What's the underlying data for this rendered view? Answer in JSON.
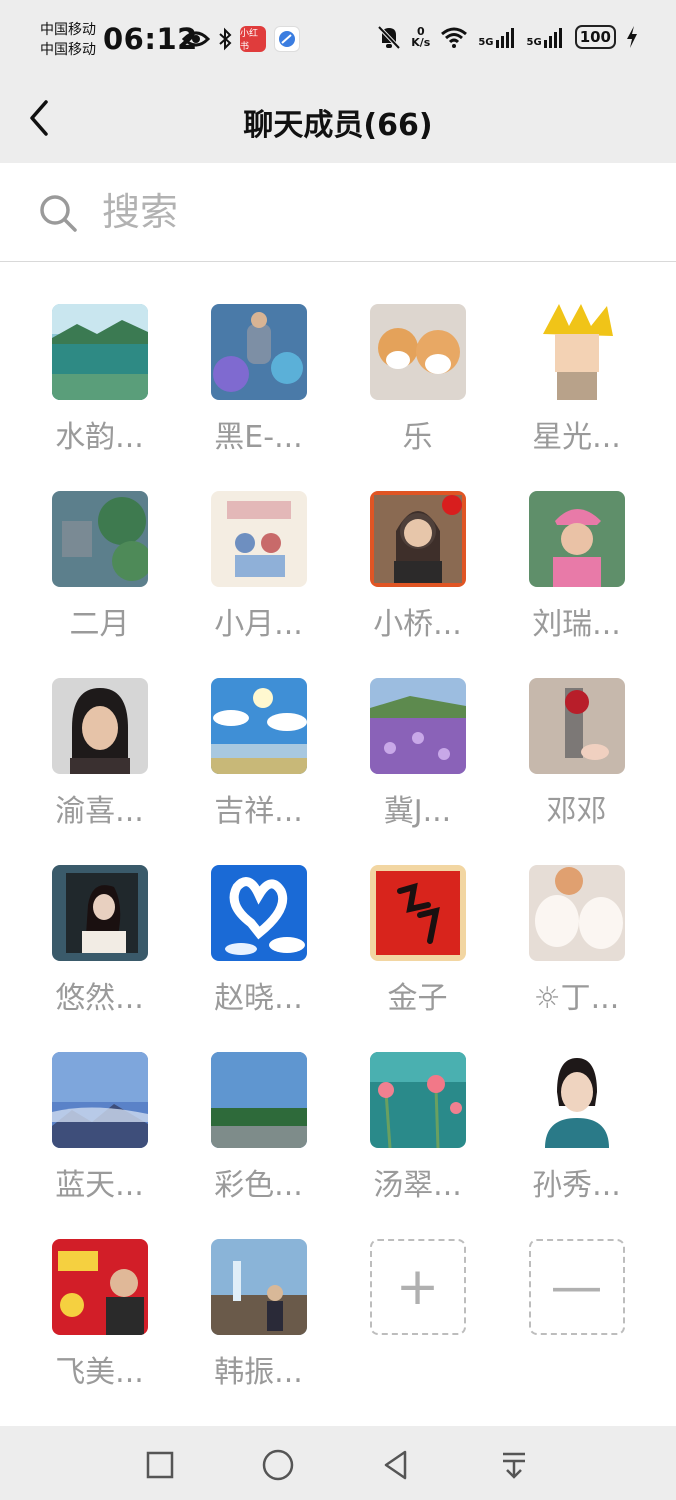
{
  "status_bar": {
    "carrier_1": "中国移动",
    "carrier_2": "中国移动",
    "time": "06:12",
    "app_badge_text": "小红书",
    "net_speed_value": "0",
    "net_speed_unit": "K/s",
    "sig1_label": "5G",
    "sig2_label": "5G",
    "battery": "100"
  },
  "header": {
    "title": "聊天成员(66)",
    "back_icon": "chevron-left-icon"
  },
  "search": {
    "placeholder": "搜索",
    "icon": "search-icon"
  },
  "members": [
    {
      "name": "水韵..."
    },
    {
      "name": "黑E-..."
    },
    {
      "name": "乐"
    },
    {
      "name": "星光..."
    },
    {
      "name": "二月"
    },
    {
      "name": "小月..."
    },
    {
      "name": "小桥..."
    },
    {
      "name": "刘瑞..."
    },
    {
      "name": "渝喜..."
    },
    {
      "name": "吉祥..."
    },
    {
      "name": "冀J..."
    },
    {
      "name": "邓邓"
    },
    {
      "name": "悠然..."
    },
    {
      "name": "赵晓..."
    },
    {
      "name": "金子"
    },
    {
      "name": "☼丁..."
    },
    {
      "name": "蓝天..."
    },
    {
      "name": "彩色..."
    },
    {
      "name": "汤翠..."
    },
    {
      "name": "孙秀..."
    },
    {
      "name": "飞美..."
    },
    {
      "name": "韩振..."
    }
  ],
  "actions": {
    "add_symbol": "+",
    "remove_symbol": "—"
  },
  "nav_bar": {
    "icons": [
      "square-icon",
      "circle-icon",
      "triangle-back-icon",
      "menu-down-icon"
    ]
  },
  "colors": {
    "background": "#ededed",
    "name_text": "#9a9a9a",
    "placeholder": "#b2b2b2"
  }
}
